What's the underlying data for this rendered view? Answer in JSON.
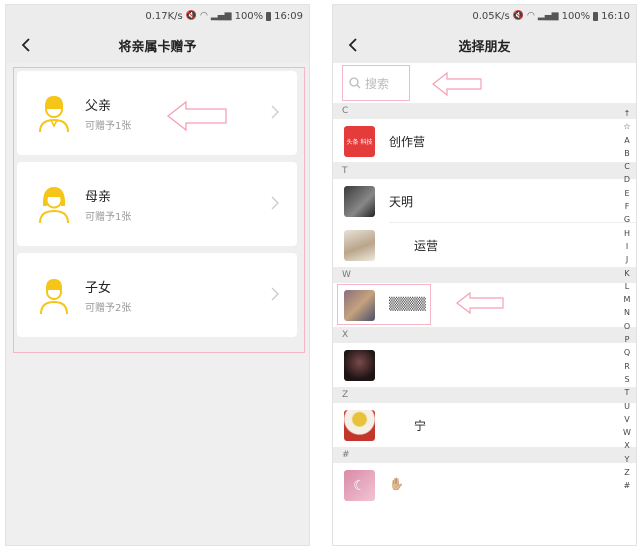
{
  "left": {
    "status": {
      "speed": "0.17K/s",
      "battery": "100%",
      "time": "16:09"
    },
    "title": "将亲属卡赠予",
    "cards": [
      {
        "name": "父亲",
        "sub": "可赠予1张"
      },
      {
        "name": "母亲",
        "sub": "可赠予1张"
      },
      {
        "name": "子女",
        "sub": "可赠予2张"
      }
    ]
  },
  "right": {
    "status": {
      "speed": "0.05K/s",
      "battery": "100%",
      "time": "16:10"
    },
    "title": "选择朋友",
    "search_placeholder": "搜索",
    "sections": [
      {
        "letter": "C",
        "rows": [
          {
            "name": "创作营",
            "thumb_text": "头条 科技"
          }
        ]
      },
      {
        "letter": "T",
        "rows": [
          {
            "name": "天明"
          },
          {
            "name": "运营"
          }
        ]
      },
      {
        "letter": "W",
        "rows": [
          {
            "name": "▒▒▒▒"
          }
        ]
      },
      {
        "letter": "X",
        "rows": [
          {
            "name": ""
          }
        ]
      },
      {
        "letter": "Z",
        "rows": [
          {
            "name": "宁"
          }
        ]
      },
      {
        "letter": "#",
        "rows": [
          {
            "name": "✋🏼"
          }
        ]
      }
    ],
    "index_letters": [
      "↑",
      "☆",
      "A",
      "B",
      "C",
      "D",
      "E",
      "F",
      "G",
      "H",
      "I",
      "J",
      "K",
      "L",
      "M",
      "N",
      "O",
      "P",
      "Q",
      "R",
      "S",
      "T",
      "U",
      "V",
      "W",
      "X",
      "Y",
      "Z",
      "#"
    ]
  },
  "colors": {
    "accent_yellow": "#f5c518",
    "highlight_pink": "#f5b6c5"
  }
}
